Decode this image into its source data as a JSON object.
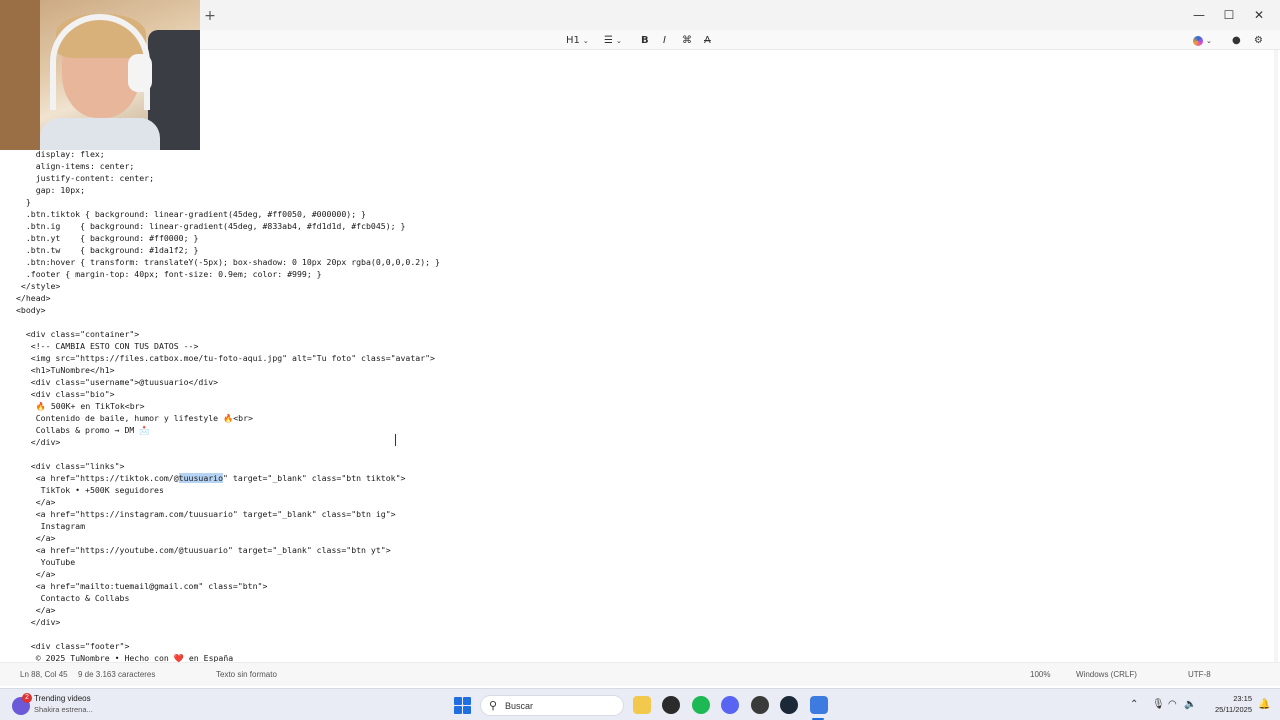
{
  "titlebar": {
    "new_tab": "+",
    "minimize": "—",
    "maximize": "☐",
    "close": "✕"
  },
  "toolbar": {
    "heading": "H1",
    "list": "☰",
    "bold": "B",
    "italic": "I",
    "link": "⌘",
    "clear_format": "A"
  },
  "code_lines": [
    "    display: flex;",
    "    align-items: center;",
    "    justify-content: center;",
    "    gap: 10px;",
    "  }",
    "  .btn.tiktok { background: linear-gradient(45deg, #ff0050, #000000); }",
    "  .btn.ig    { background: linear-gradient(45deg, #833ab4, #fd1d1d, #fcb045); }",
    "  .btn.yt    { background: #ff0000; }",
    "  .btn.tw    { background: #1da1f2; }",
    "  .btn:hover { transform: translateY(-5px); box-shadow: 0 10px 20px rgba(0,0,0,0.2); }",
    "  .footer { margin-top: 40px; font-size: 0.9em; color: #999; }",
    " </style>",
    "</head>",
    "<body>",
    "",
    "  <div class=\"container\">",
    "   <!-- CAMBIA ESTO CON TUS DATOS -->",
    "   <img src=\"https://files.catbox.moe/tu-foto-aqui.jpg\" alt=\"Tu foto\" class=\"avatar\">",
    "   <h1>TuNombre</h1>",
    "   <div class=\"username\">@tuusuario</div>",
    "   <div class=\"bio\">",
    "    🔥 500K+ en TikTok<br>",
    "    Contenido de baile, humor y lifestyle 🔥<br>",
    "    Collabs & promo → DM 📩",
    "   </div>",
    "",
    "   <div class=\"links\">",
    "    <a href=\"https://tiktok.com/@tuusuario\" target=\"_blank\" class=\"btn tiktok\">",
    "     TikTok • +500K seguidores",
    "    </a>",
    "    <a href=\"https://instagram.com/tuusuario\" target=\"_blank\" class=\"btn ig\">",
    "     Instagram",
    "    </a>",
    "    <a href=\"https://youtube.com/@tuusuario\" target=\"_blank\" class=\"btn yt\">",
    "     YouTube",
    "    </a>",
    "    <a href=\"mailto:tuemail@gmail.com\" class=\"btn\">",
    "     Contacto & Collabs",
    "    </a>",
    "   </div>",
    "",
    "   <div class=\"footer\">",
    "    © 2025 TuNombre • Hecho con ❤️ en España"
  ],
  "selection": {
    "line_index": 27,
    "text": "tuusuario"
  },
  "statusbar": {
    "position": "Ln 88, Col 45",
    "chars": "9 de 3.163 caracteres",
    "format": "Texto sin formato",
    "zoom": "100%",
    "line_endings": "Windows (CRLF)",
    "encoding": "UTF-8"
  },
  "taskbar": {
    "widget_badge": "2",
    "widget_title": "Trending videos",
    "widget_subtitle": "Shakira estrena...",
    "search_placeholder": "Buscar",
    "time": "23:15",
    "date": "25/11/2025"
  },
  "colors": {
    "accent": "#1f6fe0",
    "selection": "#b5d3f3"
  }
}
